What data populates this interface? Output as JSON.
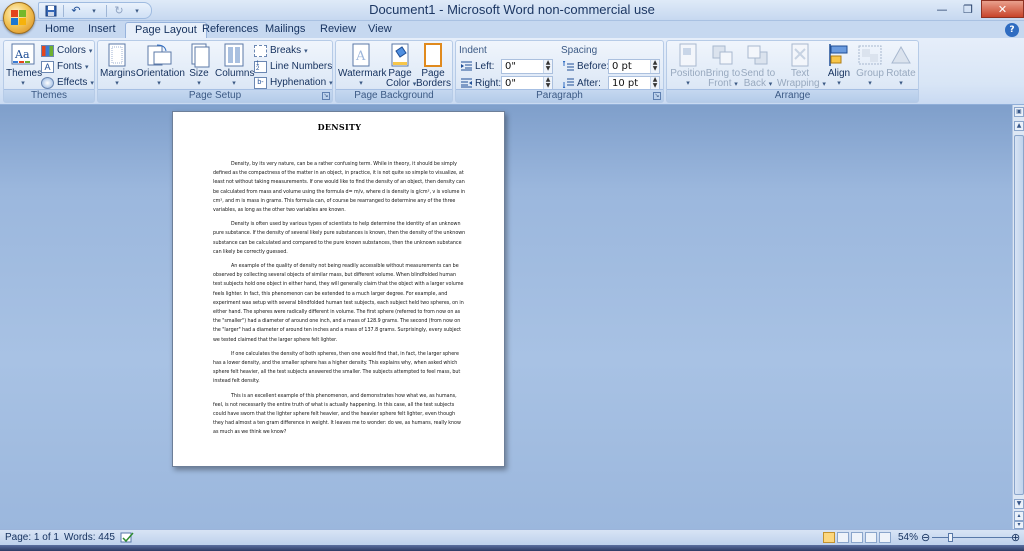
{
  "window": {
    "title": "Document1 - Microsoft Word non-commercial use",
    "controls": {
      "minimize": "—",
      "maximize": "❐",
      "close": "✕"
    }
  },
  "qat": {
    "save_icon": "save-icon",
    "undo_icon": "undo-icon",
    "redo_icon": "redo-icon",
    "customize": "▾"
  },
  "tabs": [
    {
      "label": "Home"
    },
    {
      "label": "Insert"
    },
    {
      "label": "Page Layout"
    },
    {
      "label": "References"
    },
    {
      "label": "Mailings"
    },
    {
      "label": "Review"
    },
    {
      "label": "View"
    }
  ],
  "active_tab": "Page Layout",
  "ribbon": {
    "themes": {
      "group_label": "Themes",
      "themes_btn": "Themes",
      "colors": "Colors",
      "fonts": "Fonts",
      "effects": "Effects"
    },
    "page_setup": {
      "group_label": "Page Setup",
      "margins": "Margins",
      "orientation": "Orientation",
      "size": "Size",
      "columns": "Columns",
      "breaks": "Breaks",
      "line_numbers": "Line Numbers",
      "hyphenation": "Hyphenation"
    },
    "page_background": {
      "group_label": "Page Background",
      "watermark": "Watermark",
      "page_color_1": "Page",
      "page_color_2": "Color",
      "page_borders_1": "Page",
      "page_borders_2": "Borders"
    },
    "paragraph": {
      "group_label": "Paragraph",
      "indent_title": "Indent",
      "left_label": "Left:",
      "left_value": "0\"",
      "right_label": "Right:",
      "right_value": "0\"",
      "spacing_title": "Spacing",
      "before_label": "Before:",
      "before_value": "0 pt",
      "after_label": "After:",
      "after_value": "10 pt"
    },
    "arrange": {
      "group_label": "Arrange",
      "position": "Position",
      "bring_to_front_1": "Bring to",
      "bring_to_front_2": "Front",
      "send_to_back_1": "Send to",
      "send_to_back_2": "Back",
      "text_wrapping_1": "Text",
      "text_wrapping_2": "Wrapping",
      "align": "Align",
      "group": "Group",
      "rotate": "Rotate"
    }
  },
  "document": {
    "title": "DENSITY",
    "paragraphs": [
      "Density, by its very nature, can be a rather confusing term. While in theory, it should be simply defined as the compactness of the matter in an object, in practice, it is not quite so simple to visualize, at least not without taking measurements. If one would like to find the density of an object, then density can be calculated from mass and volume using the formula d= m/v, where d is density is g/cm³, v is volume in cm³, and m is mass in grams. This formula can, of course be rearranged to determine any of the three variables, as long as the other two variables are known.",
      "Density is often used by various types of scientists to help determine the identity of an unknown pure substance. If the density of several likely pure substances is known, then the density of the unknown substance can be calculated and compared to the pure known substances, then the unknown substance can likely be correctly guessed.",
      "An example of the quality of density not being readily accessible without measurements can be observed by collecting several objects of similar mass, but different volume. When blindfolded human test subjects hold one object in either hand, they will generally claim that the object with a larger volume feels lighter. In fact, this phenomenon can be extended to a much larger degree. For example, and experiment was setup with several blindfolded human test subjects, each subject held two spheres, on in either hand. The spheres were radically different in volume. The first sphere (referred to from now on as the \"smaller\") had a diameter of around one inch, and a mass of 128.9 grams. The second (from now on the \"larger\" had a diameter of around ten inches and a mass of 137.8 grams. Surprisingly, every subject we tested claimed that the larger sphere felt lighter.",
      "If one calculates the density of both spheres, then one would find that, in fact, the larger sphere has a lower density, and the smaller sphere has a higher density. This explains why, when asked which sphere felt heavier, all the test subjects answered the smaller. The subjects attempted to feel mass, but instead felt density.",
      "This is an excellent example of this phenomenon, and demonstrates how what we, as humans, feel, is not necessarily the entire truth of what is actually happening. In this case, all the test subjects could have sworn that the lighter sphere felt heavier, and the heavier sphere felt lighter, even though they had almost a ten gram difference in weight. It leaves me to wonder: do we, as humans, really know as much as we think we know?"
    ]
  },
  "statusbar": {
    "page": "Page: 1 of 1",
    "words": "Words: 445",
    "zoom": "54%"
  },
  "colors": {
    "ribbon": "#dfe9f6",
    "workarea": "#9db8dc",
    "accent": "#1f4e96"
  }
}
